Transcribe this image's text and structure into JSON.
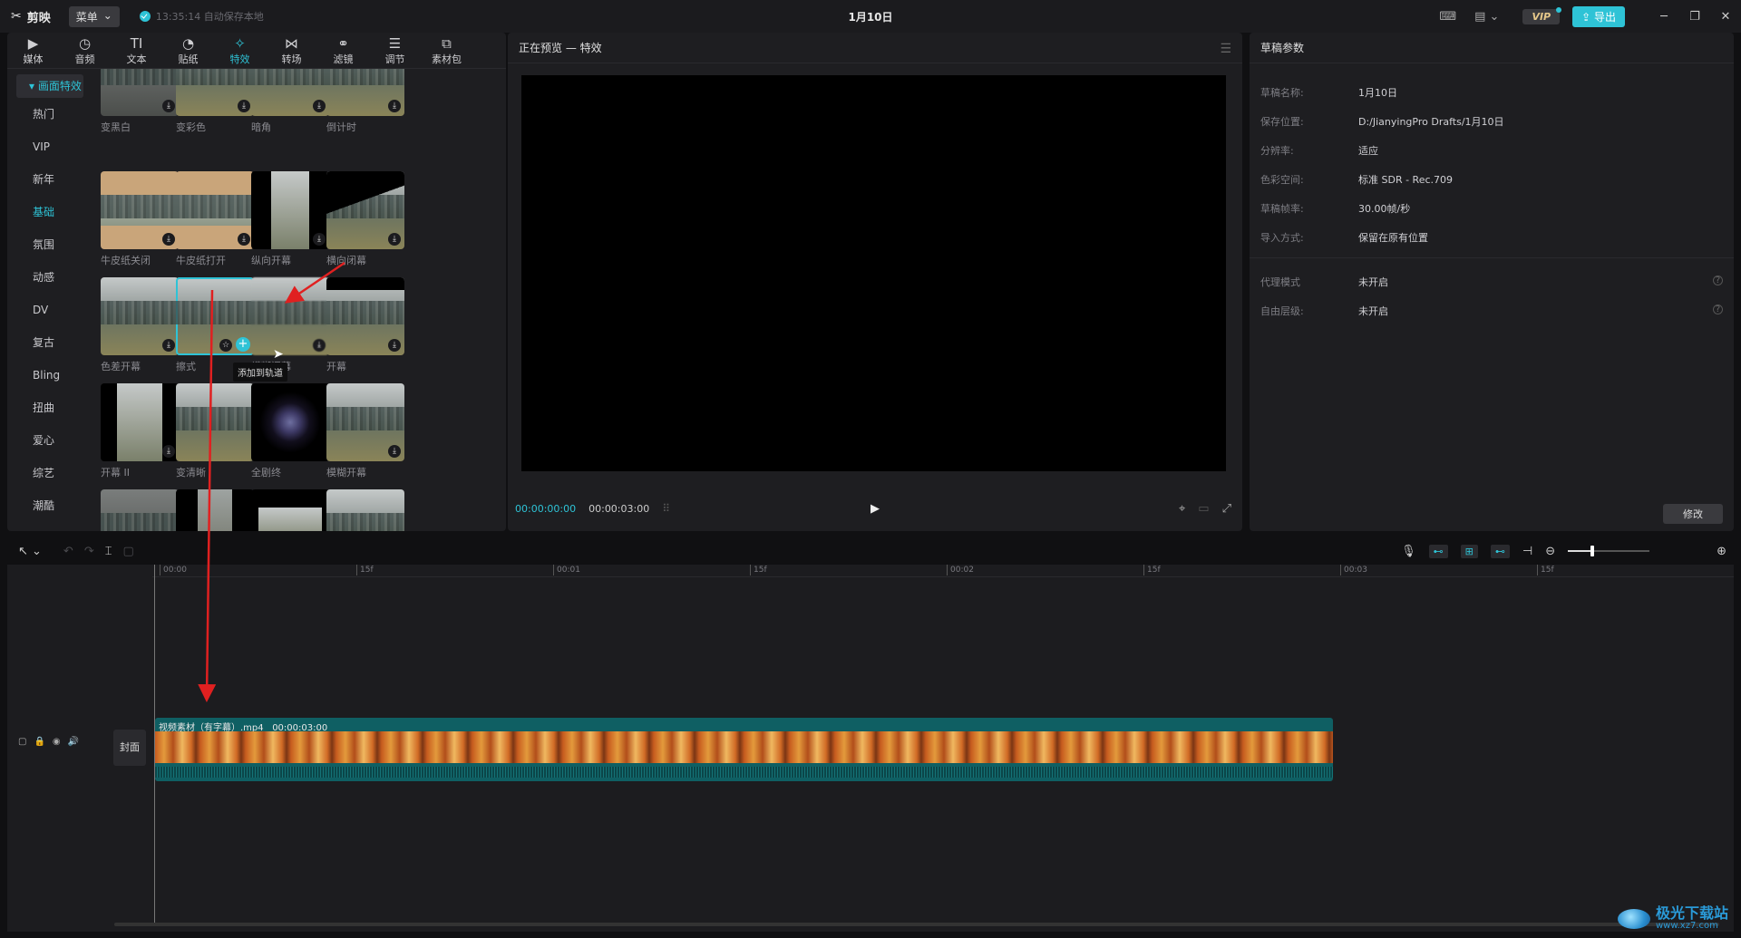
{
  "titlebar": {
    "app_name": "剪映",
    "menu_label": "菜单",
    "save_status": "13:35:14 自动保存本地",
    "title": "1月10日",
    "vip_label": "VIP",
    "export_label": "导出"
  },
  "tools": [
    {
      "label": "媒体",
      "icon": "media-icon"
    },
    {
      "label": "音频",
      "icon": "audio-icon"
    },
    {
      "label": "文本",
      "icon": "text-icon"
    },
    {
      "label": "贴纸",
      "icon": "sticker-icon"
    },
    {
      "label": "特效",
      "icon": "effects-icon"
    },
    {
      "label": "转场",
      "icon": "transition-icon"
    },
    {
      "label": "滤镜",
      "icon": "filter-icon"
    },
    {
      "label": "调节",
      "icon": "adjust-icon"
    },
    {
      "label": "素材包",
      "icon": "package-icon"
    }
  ],
  "nav": {
    "header": "画面特效",
    "items": [
      "热门",
      "VIP",
      "新年",
      "基础",
      "氛围",
      "动感",
      "DV",
      "复古",
      "Bling",
      "扭曲",
      "爱心",
      "综艺",
      "潮酷"
    ],
    "active": "基础"
  },
  "effects": [
    {
      "label": "变黑白"
    },
    {
      "label": "变彩色"
    },
    {
      "label": "暗角"
    },
    {
      "label": "倒计时"
    },
    {
      "label": "牛皮纸关闭"
    },
    {
      "label": "牛皮纸打开"
    },
    {
      "label": "纵向开幕"
    },
    {
      "label": "横向闭幕"
    },
    {
      "label": "色差开幕"
    },
    {
      "label": "擦式"
    },
    {
      "label": "模糊闭幕"
    },
    {
      "label": "开幕"
    },
    {
      "label": "开幕 II"
    },
    {
      "label": "变清晰"
    },
    {
      "label": "全剧终"
    },
    {
      "label": "模糊开幕"
    },
    {
      "label": ""
    },
    {
      "label": ""
    },
    {
      "label": ""
    },
    {
      "label": ""
    }
  ],
  "tooltip": "添加到轨道",
  "preview": {
    "title": "正在预览 — 特效",
    "current_time": "00:00:00:00",
    "total_time": "00:00:03:00"
  },
  "props": {
    "title": "草稿参数",
    "rows": [
      {
        "key": "草稿名称:",
        "value": "1月10日"
      },
      {
        "key": "保存位置:",
        "value": "D:/JianyingPro Drafts/1月10日"
      },
      {
        "key": "分辨率:",
        "value": "适应"
      },
      {
        "key": "色彩空间:",
        "value": "标准 SDR - Rec.709"
      },
      {
        "key": "草稿帧率:",
        "value": "30.00帧/秒"
      },
      {
        "key": "导入方式:",
        "value": "保留在原有位置"
      }
    ],
    "rows2": [
      {
        "key": "代理模式",
        "value": "未开启"
      },
      {
        "key": "自由层级:",
        "value": "未开启"
      }
    ],
    "modify_label": "修改"
  },
  "timeline": {
    "ticks": [
      "00:00",
      "15f",
      "00:01",
      "15f",
      "00:02",
      "15f",
      "00:03",
      "15f"
    ],
    "zoom_level": 0.3,
    "cover_label": "封面",
    "clip_name": "视频素材（有字幕）.mp4",
    "clip_duration": "00:00:03:00"
  },
  "watermark": {
    "text": "极光下载站",
    "url": "www.xz7.com"
  },
  "colors": {
    "accent": "#2ec3d6",
    "arrow": "#e02020"
  }
}
